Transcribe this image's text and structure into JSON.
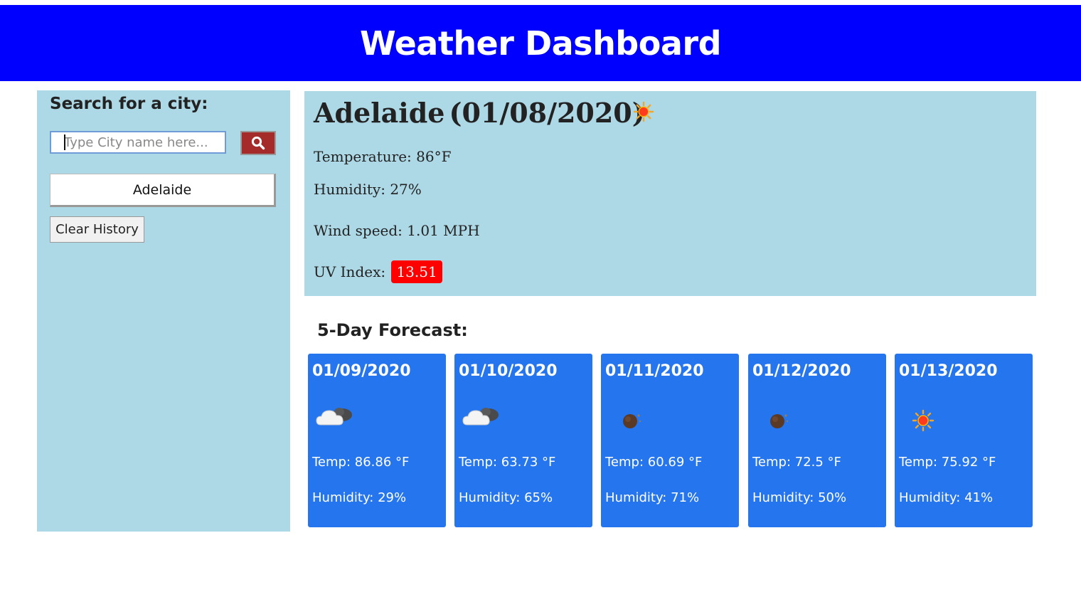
{
  "header": {
    "title": "Weather Dashboard"
  },
  "sidebar": {
    "search_title": "Search for a city:",
    "search_placeholder": "Type City name here...",
    "search_button_icon": "search-icon",
    "history": [
      "Adelaide"
    ],
    "clear_label": "Clear History"
  },
  "current": {
    "city": "Adelaide",
    "date": "(01/08/2020)",
    "icon": "sun-icon",
    "temperature": "Temperature: 86°F",
    "humidity": "Humidity: 27%",
    "wind": "Wind speed: 1.01 MPH",
    "uv_label": "UV Index:",
    "uv_value": "13.51",
    "uv_color": "#ff0000"
  },
  "forecast": {
    "title": "5-Day Forecast:",
    "days": [
      {
        "date": "01/09/2020",
        "icon": "partly-cloudy-night-icon",
        "temp": "Temp: 86.86 °F",
        "humidity": "Humidity: 29%"
      },
      {
        "date": "01/10/2020",
        "icon": "partly-cloudy-night-icon",
        "temp": "Temp: 63.73 °F",
        "humidity": "Humidity: 65%"
      },
      {
        "date": "01/11/2020",
        "icon": "moon-icon",
        "temp": "Temp: 60.69 °F",
        "humidity": "Humidity: 71%"
      },
      {
        "date": "01/12/2020",
        "icon": "moon-icon",
        "temp": "Temp: 72.5 °F",
        "humidity": "Humidity: 50%"
      },
      {
        "date": "01/13/2020",
        "icon": "sun-icon",
        "temp": "Temp: 75.92 °F",
        "humidity": "Humidity: 41%"
      }
    ]
  },
  "colors": {
    "header_bg": "#0000ff",
    "panel_bg": "#add8e6",
    "card_bg": "#2575ee",
    "search_button_bg": "#a52a2a"
  }
}
